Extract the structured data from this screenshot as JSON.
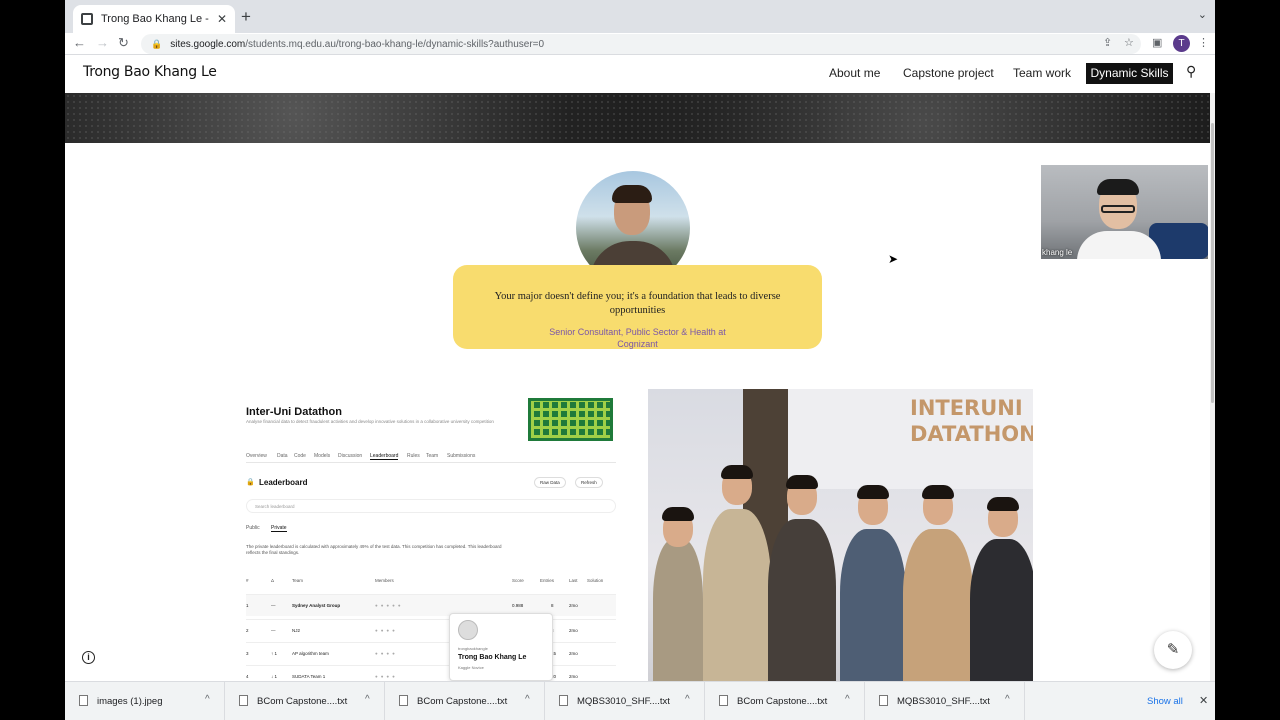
{
  "browser": {
    "tab_title": "Trong Bao Khang Le - Dynamic",
    "tab_close": "✕",
    "new_tab": "+",
    "url_host": "sites.google.com",
    "url_path": "/students.mq.edu.au/trong-bao-khang-le/dynamic-skills?authuser=0",
    "profile_initial": "T"
  },
  "site": {
    "title": "Trong Bao Khang Le",
    "nav": [
      "About me",
      "Capstone project",
      "Team work",
      "Dynamic Skills"
    ]
  },
  "quote": {
    "text": "Your major doesn't define you; it's a foundation that leads to diverse opportunities",
    "author": "Senior Consultant, Public Sector & Health at Cognizant"
  },
  "leaderboard": {
    "title": "Inter-Uni Datathon",
    "description": "Analyse financial data to detect fraudulent activities and develop innovative solutions in a collaborative university competition",
    "tabs": [
      "Overview",
      "Data",
      "Code",
      "Models",
      "Discussion",
      "Leaderboard",
      "Rules",
      "Team",
      "Submissions"
    ],
    "heading": "Leaderboard",
    "raw_data_btn": "Raw Data",
    "refresh_btn": "Refresh",
    "search_placeholder": "Search leaderboard",
    "subtabs": [
      "Public",
      "Private"
    ],
    "note": "The private leaderboard is calculated with approximately 49% of the test data. This competition has completed. This leaderboard reflects the final standings.",
    "columns": [
      "#",
      "Δ",
      "Team",
      "Members",
      "Score",
      "Entries",
      "Last",
      "Solution"
    ],
    "rows": [
      {
        "rank": "1",
        "delta": "—",
        "team": "Sydney Analyst Group",
        "score": "0.988",
        "entries": "8",
        "last": "2mo"
      },
      {
        "rank": "2",
        "delta": "—",
        "team": "NJ2",
        "score": "",
        "entries": "3",
        "last": "2mo"
      },
      {
        "rank": "3",
        "delta": "↑ 1",
        "team": "AP algorithm team",
        "score": "",
        "entries": "15",
        "last": "2mo"
      },
      {
        "rank": "4",
        "delta": "↓ 1",
        "team": "SUDATA Team 1",
        "score": "",
        "entries": "20",
        "last": "2mo"
      }
    ],
    "hover_name": "Trong Bao Khang Le",
    "hover_handle": "trongbaokhangle",
    "hover_rank": "Kaggle Novice"
  },
  "photo": {
    "banner_text": "INTERUNI DATATHON"
  },
  "webcam": {
    "label": "khang le"
  },
  "downloads": {
    "items": [
      "images (1).jpeg",
      "BCom Capstone....txt",
      "BCom Capstone....txt",
      "MQBS3010_SHF....txt",
      "BCom Capstone....txt",
      "MQBS3010_SHF....txt"
    ],
    "show_all": "Show all"
  }
}
